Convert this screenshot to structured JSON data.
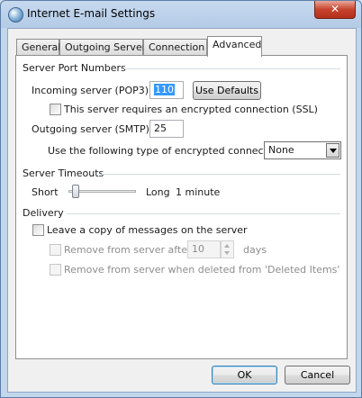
{
  "window": {
    "title": "Internet E-mail Settings",
    "close_label": "✕"
  },
  "tabs": [
    {
      "label": "General"
    },
    {
      "label": "Outgoing Server"
    },
    {
      "label": "Connection"
    },
    {
      "label": "Advanced",
      "active": true
    }
  ],
  "server_ports": {
    "heading": "Server Port Numbers",
    "incoming_label": "Incoming server (POP3):",
    "incoming_value": "110",
    "use_defaults_label": "Use Defaults",
    "ssl_label": "This server requires an encrypted connection (SSL)",
    "ssl_checked": false,
    "outgoing_label": "Outgoing server (SMTP):",
    "outgoing_value": "25",
    "encryption_label": "Use the following type of encrypted connection:",
    "encryption_value": "None"
  },
  "timeouts": {
    "heading": "Server Timeouts",
    "short_label": "Short",
    "long_label": "Long",
    "value_label": "1 minute",
    "level": 0.04
  },
  "delivery": {
    "heading": "Delivery",
    "leave_copy_label": "Leave a copy of messages on the server",
    "leave_copy_checked": false,
    "remove_after_label": "Remove from server after",
    "remove_after_value": "10",
    "days_label": "days",
    "remove_deleted_label": "Remove from server when deleted from 'Deleted Items'"
  },
  "buttons": {
    "ok_label": "OK",
    "cancel_label": "Cancel"
  },
  "colors": {
    "title_bar": "#b4cbe6",
    "close_button": "#c7432c",
    "selection": "#3399ff"
  }
}
